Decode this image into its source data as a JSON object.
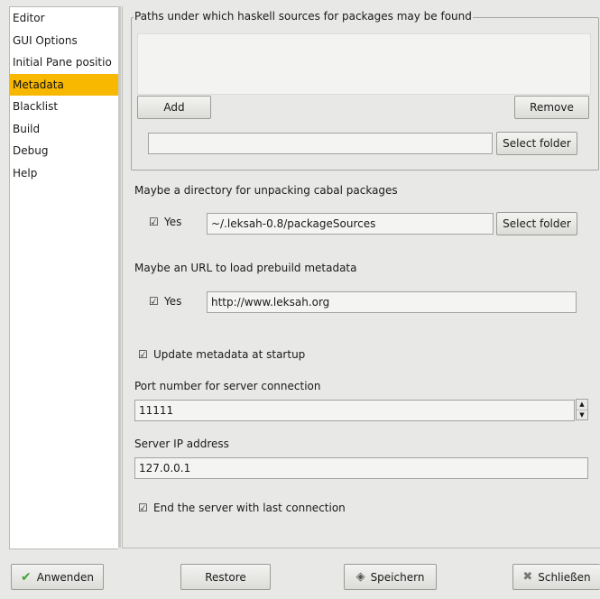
{
  "sidebar": {
    "items": [
      {
        "label": "Editor",
        "selected": false
      },
      {
        "label": "GUI Options",
        "selected": false
      },
      {
        "label": "Initial Pane positio",
        "selected": false
      },
      {
        "label": "Metadata",
        "selected": true
      },
      {
        "label": "Blacklist",
        "selected": false
      },
      {
        "label": "Build",
        "selected": false
      },
      {
        "label": "Debug",
        "selected": false
      },
      {
        "label": "Help",
        "selected": false
      }
    ],
    "selected_color": "#f8b800"
  },
  "paths_frame": {
    "title": "Paths under which haskell sources for packages may be found",
    "add_label": "Add",
    "remove_label": "Remove",
    "path_value": "",
    "select_folder_label": "Select folder"
  },
  "unpack": {
    "heading": "Maybe a directory for unpacking cabal packages",
    "yes_label": "Yes",
    "checked": true,
    "path_value": "~/.leksah-0.8/packageSources",
    "select_folder_label": "Select folder"
  },
  "metadata_url": {
    "heading": "Maybe an URL to load prebuild metadata",
    "yes_label": "Yes",
    "checked": true,
    "url_value": "http://www.leksah.org"
  },
  "update_at_startup": {
    "label": "Update metadata at startup",
    "checked": true
  },
  "port": {
    "heading": "Port number for server connection",
    "value": "11111"
  },
  "server_ip": {
    "heading": "Server IP address",
    "value": "127.0.0.1"
  },
  "end_server": {
    "label": "End the server with last connection",
    "checked": true
  },
  "footer": {
    "apply_label": "Anwenden",
    "restore_label": "Restore",
    "save_label": "Speichern",
    "close_label": "Schließen"
  },
  "icons": {
    "apply": "checkmark-icon",
    "save": "save-icon",
    "close": "close-icon",
    "check": "checkbox-check-icon"
  }
}
